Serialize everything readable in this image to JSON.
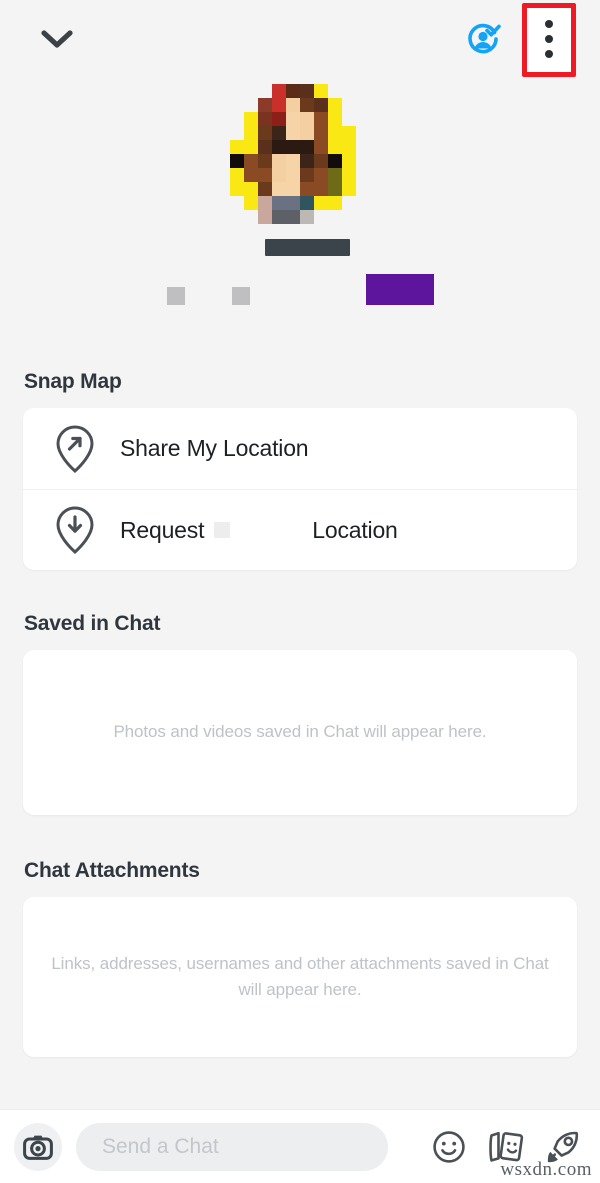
{
  "header": {
    "back_icon": "chevron-down-icon",
    "verified_icon": "friend-verified-icon",
    "menu_icon": "kebab-menu-icon",
    "highlight_color": "#ee1b24"
  },
  "profile": {
    "avatar_alt": "pixelated-profile-avatar",
    "redactions": {
      "name_bar_color": "#3b434b",
      "square_color": "#bfbfc2",
      "purple_color": "#5d159e"
    },
    "avatar_pixels": [
      [
        "#f4f4f5",
        "#f4f4f5",
        "#f4f4f5",
        "#c9302c",
        "#5d2a18",
        "#5a2f1c",
        "#f9e814",
        "#f4f4f5",
        "#f4f4f5",
        "#f4f4f5"
      ],
      [
        "#f4f4f5",
        "#f4f4f5",
        "#8c3a2a",
        "#c9302c",
        "#f3cfa2",
        "#6b3a1d",
        "#5a2f1c",
        "#f9e814",
        "#f4f4f5",
        "#f4f4f5"
      ],
      [
        "#f4f4f5",
        "#f9e814",
        "#7a3320",
        "#8c2018",
        "#f6d4a8",
        "#f3cfa2",
        "#8a4a24",
        "#f9e814",
        "#f4f4f5",
        "#f4f4f5"
      ],
      [
        "#f4f4f5",
        "#f9e814",
        "#6b3a1d",
        "#3b2418",
        "#f6d4a8",
        "#f3cfa2",
        "#8a4a24",
        "#f9e814",
        "#f9e814",
        "#f4f4f5"
      ],
      [
        "#f9e814",
        "#f9e814",
        "#5a2f1c",
        "#2a1a12",
        "#2a1a12",
        "#2a1a12",
        "#8a4a24",
        "#f9e814",
        "#f9e814",
        "#f4f4f5"
      ],
      [
        "#120d0a",
        "#8a4a24",
        "#6b3a1d",
        "#f3cfa2",
        "#f6d4a8",
        "#3b2418",
        "#6b3a1d",
        "#120d0a",
        "#f9e814",
        "#f4f4f5"
      ],
      [
        "#f9e814",
        "#8a4a24",
        "#8a4a24",
        "#f3cfa2",
        "#f6d4a8",
        "#6b3a1d",
        "#8a4a24",
        "#6e6b17",
        "#f9e814",
        "#f4f4f5"
      ],
      [
        "#f9e814",
        "#f9e814",
        "#6b3a1d",
        "#f6d4a8",
        "#f6d4a8",
        "#8a4a24",
        "#8a4a24",
        "#6e6b17",
        "#f9e814",
        "#f4f4f5"
      ],
      [
        "#f4f4f5",
        "#f9e814",
        "#c9a79c",
        "#6a7183",
        "#6a7183",
        "#2f5560",
        "#f9e814",
        "#f9e814",
        "#f4f4f5",
        "#f4f4f5"
      ],
      [
        "#f4f4f5",
        "#f4f4f5",
        "#c9a79c",
        "#5e6068",
        "#5e6068",
        "#bcb8b4",
        "#f4f4f5",
        "#f4f4f5",
        "#f4f4f5",
        "#f4f4f5"
      ]
    ]
  },
  "snap_map": {
    "title": "Snap Map",
    "rows": [
      {
        "label": "Share My Location",
        "icon": "location-pin-share-icon"
      },
      {
        "label_before": "Request",
        "label_after": "Location",
        "icon": "location-pin-request-icon",
        "redacted": true
      }
    ]
  },
  "saved_in_chat": {
    "title": "Saved in Chat",
    "empty_text": "Photos and videos saved in Chat will appear here."
  },
  "chat_attachments": {
    "title": "Chat Attachments",
    "empty_text": "Links, addresses, usernames and other attachments saved in Chat will appear here."
  },
  "bottom_bar": {
    "camera_icon": "camera-icon",
    "input_placeholder": "Send a Chat",
    "input_value": "",
    "icons": [
      {
        "name": "smiley-sticker-icon"
      },
      {
        "name": "sticker-cards-icon"
      },
      {
        "name": "rocket-icon"
      }
    ]
  },
  "watermark": {
    "text": "wsxdn.com"
  }
}
